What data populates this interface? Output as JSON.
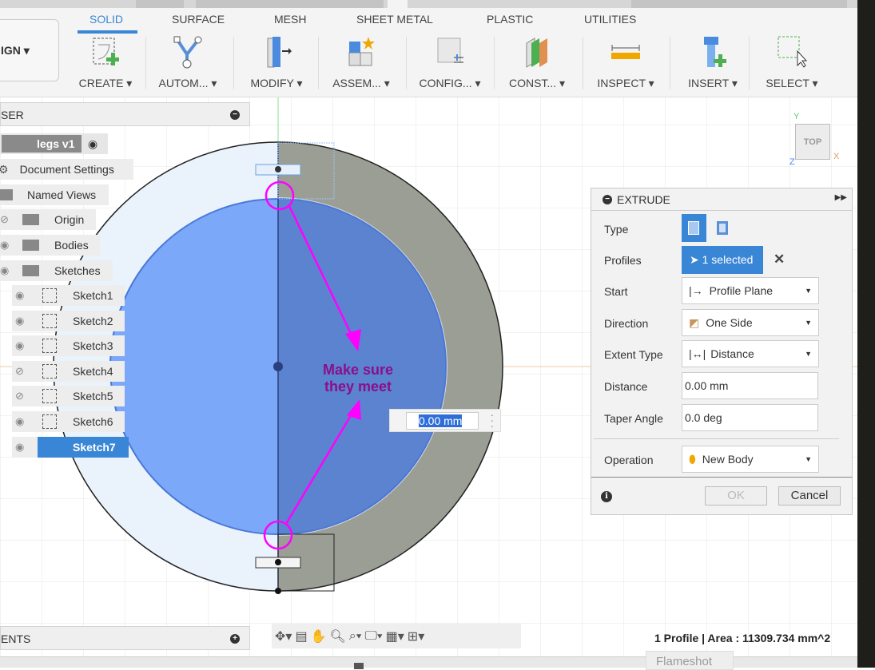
{
  "toolbar": {
    "workspace_button": "IGN",
    "tabs": [
      {
        "label": "SOLID",
        "active": true
      },
      {
        "label": "SURFACE"
      },
      {
        "label": "MESH"
      },
      {
        "label": "SHEET METAL"
      },
      {
        "label": "PLASTIC"
      },
      {
        "label": "UTILITIES"
      }
    ],
    "groups": [
      {
        "label": "CREATE ▾",
        "icon": "create-sketch-icon"
      },
      {
        "label": "AUTOM... ▾",
        "icon": "automate-icon"
      },
      {
        "label": "MODIFY ▾",
        "icon": "press-pull-icon"
      },
      {
        "label": "ASSEM... ▾",
        "icon": "new-component-icon"
      },
      {
        "label": "CONFIG... ▾",
        "icon": "configure-icon"
      },
      {
        "label": "CONST... ▾",
        "icon": "construct-plane-icon"
      },
      {
        "label": "INSPECT ▾",
        "icon": "measure-icon"
      },
      {
        "label": "INSERT ▾",
        "icon": "insert-bolt-icon"
      },
      {
        "label": "SELECT ▾",
        "icon": "select-box-icon"
      }
    ],
    "accent": "#3a86d6"
  },
  "browser": {
    "title": "SER",
    "root": "legs v1",
    "items": [
      {
        "label": "Document Settings",
        "icon": "gear-icon"
      },
      {
        "label": "Named Views",
        "icon": "folder-icon"
      },
      {
        "label": "Origin",
        "icon": "folder-icon",
        "visible": false
      },
      {
        "label": "Bodies",
        "icon": "folder-icon",
        "visible": true
      },
      {
        "label": "Sketches",
        "icon": "folder-icon",
        "visible": true
      }
    ],
    "sketches": [
      {
        "label": "Sketch1",
        "visible": true,
        "locked": true
      },
      {
        "label": "Sketch2",
        "visible": true,
        "locked": true
      },
      {
        "label": "Sketch3",
        "visible": true,
        "locked": false
      },
      {
        "label": "Sketch4",
        "visible": false,
        "locked": false
      },
      {
        "label": "Sketch5",
        "visible": false,
        "locked": false
      },
      {
        "label": "Sketch6",
        "visible": true,
        "locked": true
      },
      {
        "label": "Sketch7",
        "visible": true,
        "locked": true,
        "selected": true
      }
    ]
  },
  "comments": {
    "title": "ENTS"
  },
  "viewcube": {
    "face": "TOP",
    "axes": [
      "Y",
      "X",
      "Z"
    ]
  },
  "annotation": {
    "line1": "Make sure",
    "line2": "they meet",
    "color": "#ff00ff"
  },
  "dimension_input": {
    "value": "0.00 mm"
  },
  "extrude": {
    "title": "EXTRUDE",
    "type_label": "Type",
    "profiles_label": "Profiles",
    "profiles_value": "1 selected",
    "start_label": "Start",
    "start_value": "Profile Plane",
    "direction_label": "Direction",
    "direction_value": "One Side",
    "extent_label": "Extent Type",
    "extent_value": "Distance",
    "distance_label": "Distance",
    "distance_value": "0.00 mm",
    "taper_label": "Taper Angle",
    "taper_value": "0.0 deg",
    "operation_label": "Operation",
    "operation_value": "New Body",
    "ok": "OK",
    "cancel": "Cancel"
  },
  "status": {
    "text": "1 Profile | Area : 11309.734 mm^2"
  },
  "tooltip": {
    "text": "Flameshot"
  }
}
